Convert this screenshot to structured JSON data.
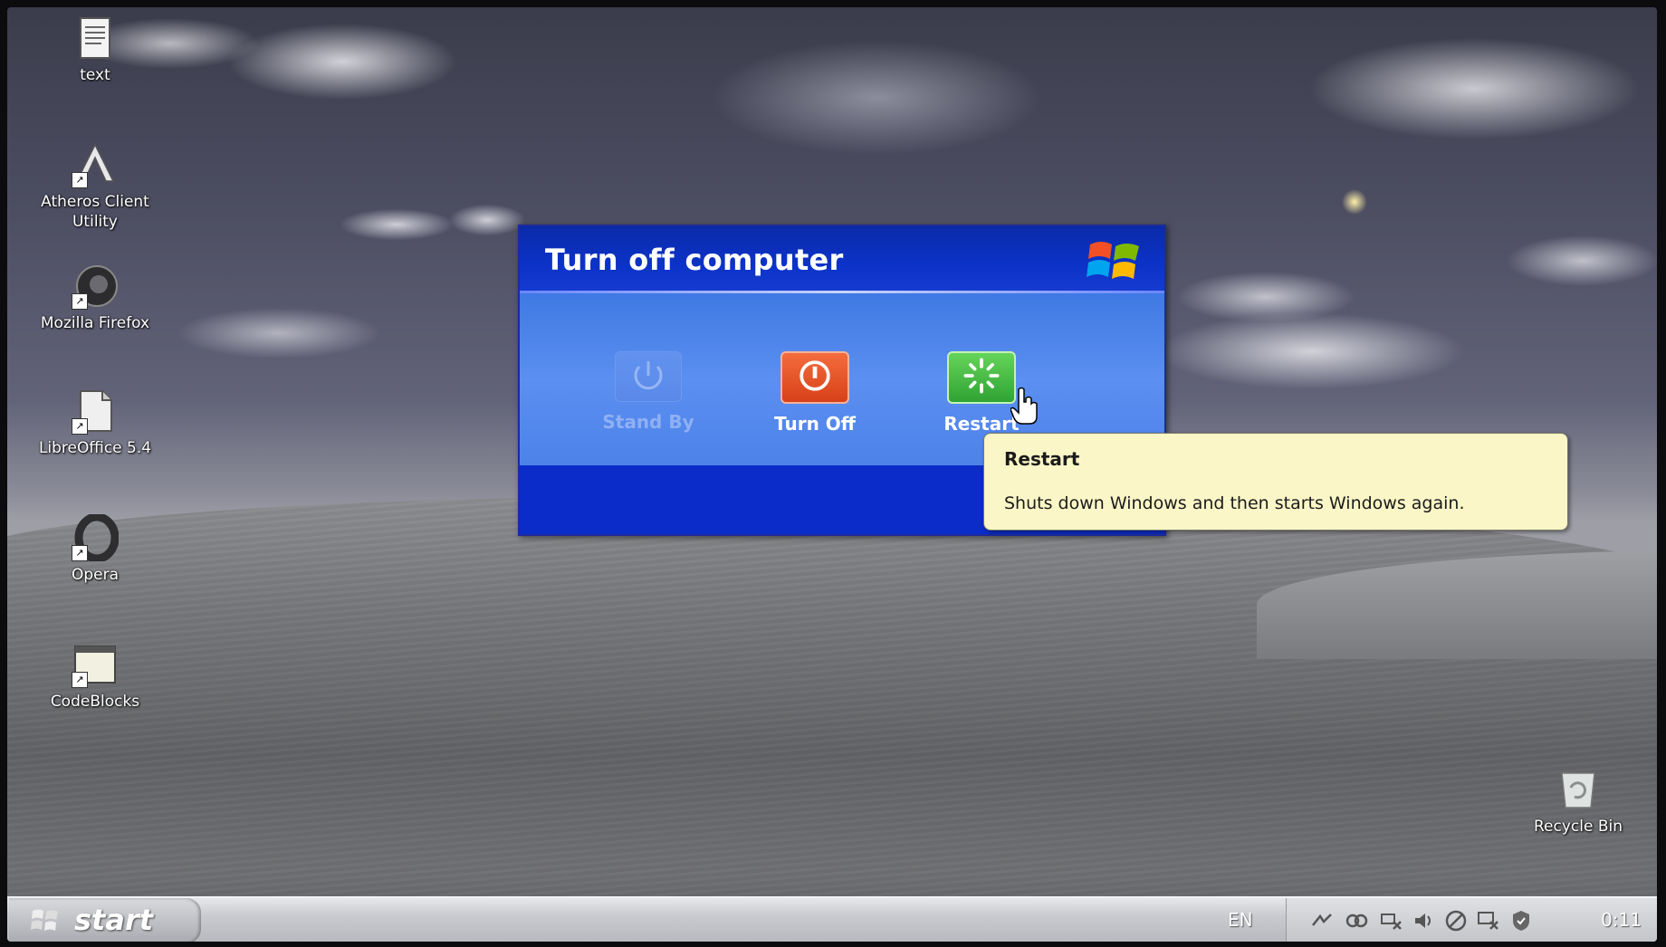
{
  "desktop": {
    "icons": [
      {
        "label": "text",
        "icon": "text-document-icon"
      },
      {
        "label": "Atheros Client Utility",
        "icon": "atheros-icon"
      },
      {
        "label": "Mozilla Firefox",
        "icon": "firefox-icon"
      },
      {
        "label": "LibreOffice 5.4",
        "icon": "libreoffice-icon"
      },
      {
        "label": "Opera",
        "icon": "opera-icon"
      },
      {
        "label": "CodeBlocks",
        "icon": "codeblocks-icon"
      },
      {
        "label": "Recycle Bin",
        "icon": "recycle-bin-icon"
      }
    ]
  },
  "dialog": {
    "title": "Turn off computer",
    "options": [
      {
        "label": "Stand By",
        "icon": "power-standby-icon",
        "enabled": false
      },
      {
        "label": "Turn Off",
        "icon": "power-off-icon",
        "enabled": true
      },
      {
        "label": "Restart",
        "icon": "restart-icon",
        "enabled": true
      }
    ]
  },
  "tooltip": {
    "title": "Restart",
    "text": "Shuts down Windows and then starts Windows again."
  },
  "taskbar": {
    "start_label": "start",
    "language": "EN",
    "clock": "0:11",
    "tray_icons": [
      "network-icon",
      "connections-icon",
      "network-disconnected-icon",
      "volume-icon",
      "blocked-icon",
      "wireless-disconnected-icon",
      "security-shield-icon"
    ]
  },
  "colors": {
    "dialog_blue": "#0c2fd2",
    "turn_off_red": "#d84118",
    "restart_green": "#2fa334",
    "tooltip_bg": "#fbf6c7"
  }
}
